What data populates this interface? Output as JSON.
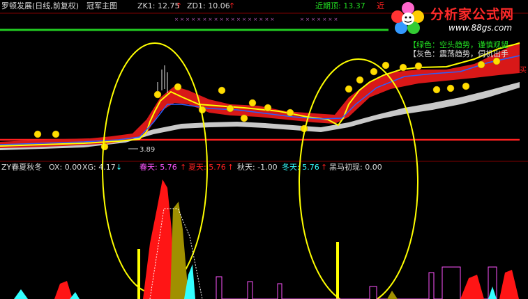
{
  "header": {
    "stock_title": "罗顿发展(日线,前复权)",
    "formula_name": "冠军主图",
    "zk1": "ZK1: 12.75",
    "zd1": "ZD1: 10.06",
    "recent_top": "近期顶: 13.37",
    "recent_cut": "近"
  },
  "logo": {
    "title": "分析家公式网",
    "url": "www.88gs.com"
  },
  "legend": {
    "line1": "【绿色：空头趋势，谨慎观望",
    "line2": "【灰色：震荡趋势，伺机出手"
  },
  "main_chart": {
    "low_marker": "3.89",
    "buy_marker": "买"
  },
  "indicator": {
    "name": "ZY春夏秋冬",
    "ox": "OX: 0.00",
    "xg": "XG: 4.17",
    "spring": "春天: 5.76",
    "summer": "夏天: 5.76",
    "autumn": "秋天: -1.00",
    "winter": "冬天: 5.76",
    "dark_horse": "黑马初现: 0.00"
  },
  "colors": {
    "bg": "#000000",
    "text_white": "#dcdcdc",
    "up_red": "#ff2020",
    "yellow": "#ffff00",
    "green": "#22dd22",
    "cyan": "#33ffff",
    "magenta": "#ff55ff",
    "olive": "#a09000",
    "gray": "#c8c8c8"
  }
}
